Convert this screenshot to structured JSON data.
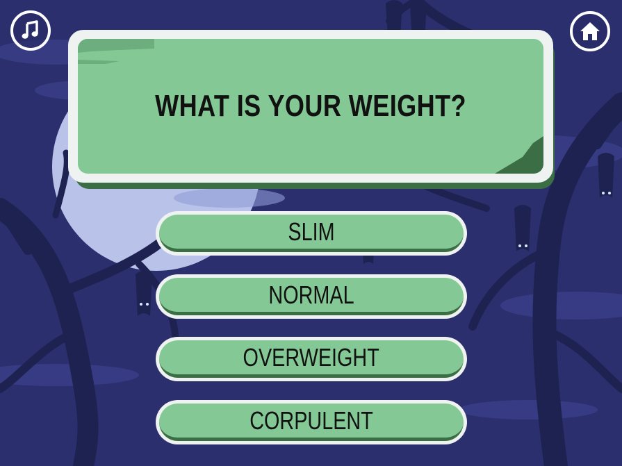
{
  "question": {
    "text": "WHAT IS YOUR WEIGHT?"
  },
  "answers": [
    {
      "label": "SLIM"
    },
    {
      "label": "NORMAL"
    },
    {
      "label": "OVERWEIGHT"
    },
    {
      "label": "CORPULENT"
    }
  ],
  "controls": {
    "music_icon": "music-note-icon",
    "home_icon": "home-icon"
  },
  "colors": {
    "background": "#2b2f6e",
    "moon": "#b9c3ea",
    "trees": "#1e2250",
    "panel_green": "#84c995",
    "panel_border": "#eef3f1",
    "panel_shadow": "#3b6e45",
    "text": "#111111"
  }
}
